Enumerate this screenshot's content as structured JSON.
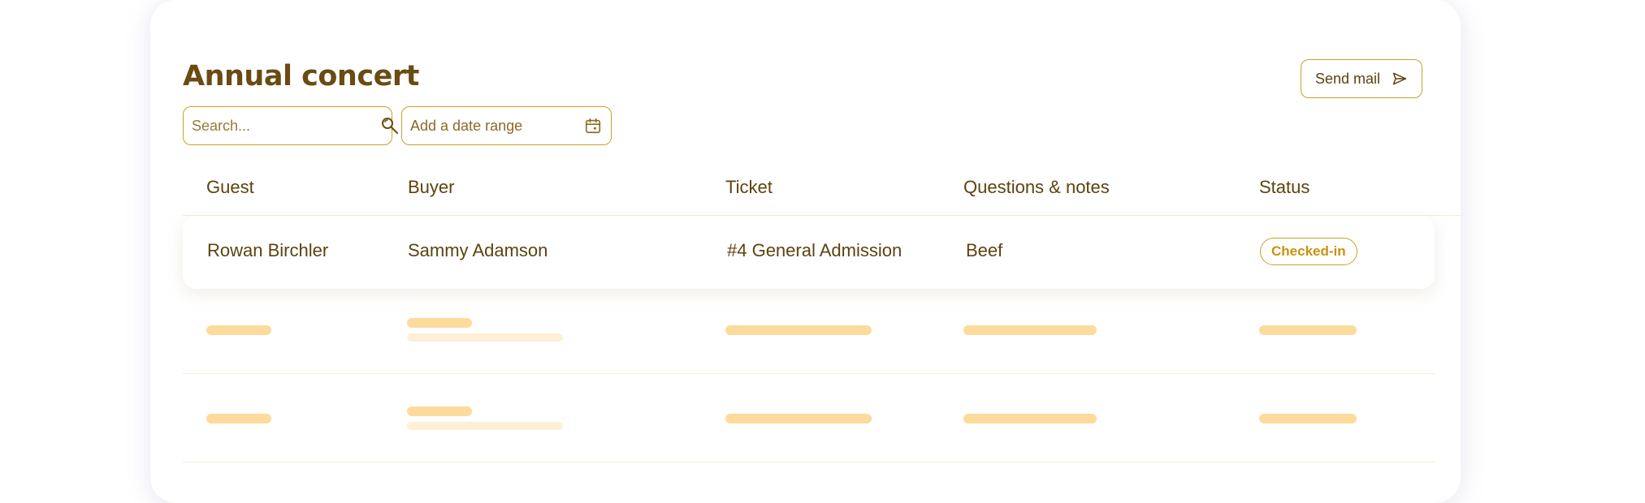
{
  "page": {
    "title": "Annual concert",
    "send_mail_label": "Send mail",
    "search": {
      "placeholder": "Search...",
      "value": ""
    },
    "date_range": {
      "label": "Add a date range"
    }
  },
  "table": {
    "columns": [
      "Guest",
      "Buyer",
      "Ticket",
      "Questions & notes",
      "Status"
    ],
    "rows": [
      {
        "guest": "Rowan Birchler",
        "buyer": "Sammy Adamson",
        "ticket": "#4 General Admission",
        "notes": "Beef",
        "status": "Checked-in"
      }
    ],
    "loading_rows": 2
  },
  "colors": {
    "accent": "#c9a227",
    "text": "#5c4310",
    "status_badge": "#c9920e",
    "skeleton": "#fddb9c",
    "skeleton_light": "#fef0d5"
  },
  "icons": [
    "search-icon",
    "calendar-icon",
    "send-icon"
  ]
}
